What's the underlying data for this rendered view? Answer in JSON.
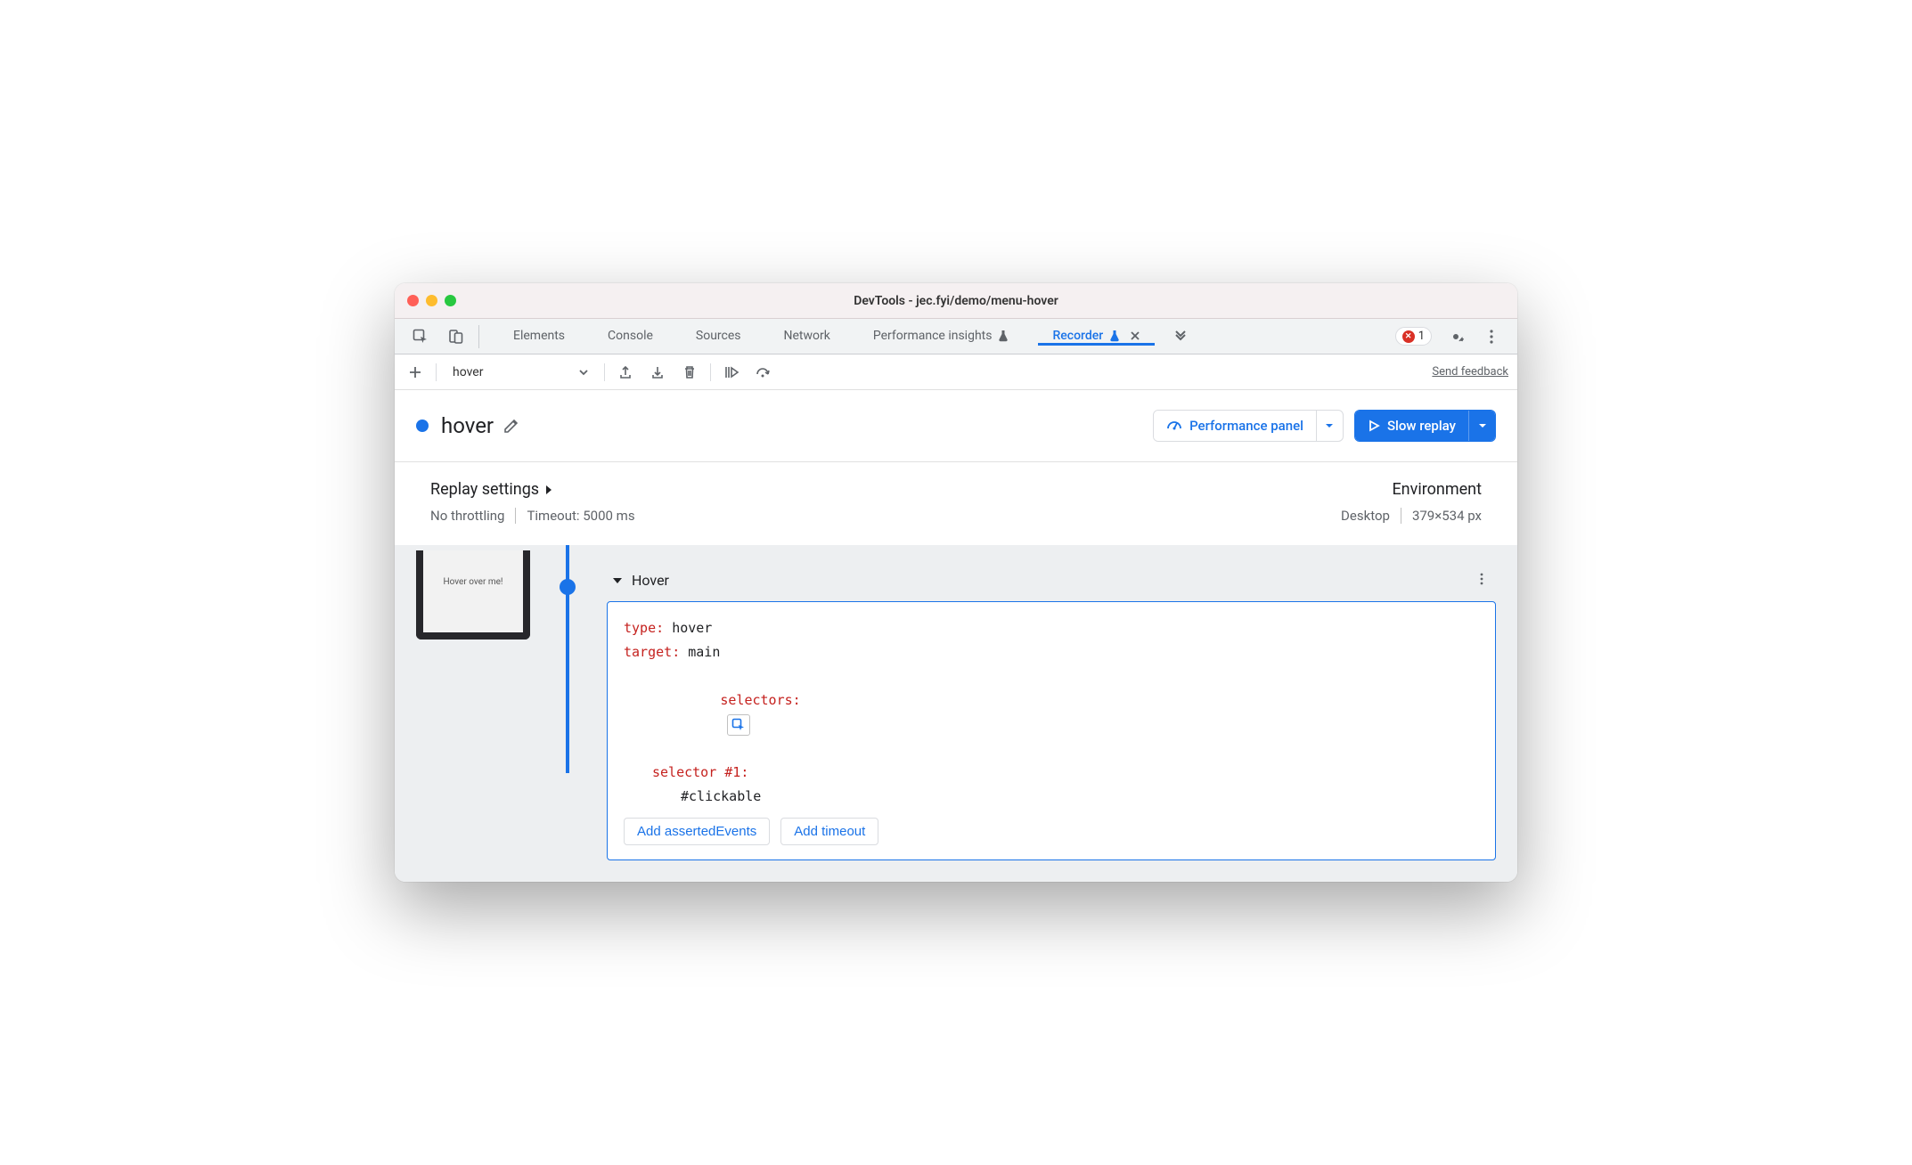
{
  "window": {
    "title": "DevTools - jec.fyi/demo/menu-hover"
  },
  "tabs": {
    "items": [
      "Elements",
      "Console",
      "Sources",
      "Network",
      "Performance insights",
      "Recorder"
    ],
    "active": "Recorder",
    "error_count": "1"
  },
  "toolbar": {
    "recording_selector": "hover",
    "feedback": "Send feedback"
  },
  "recording": {
    "title": "hover",
    "perf_button": "Performance panel",
    "replay_button": "Slow replay"
  },
  "settings": {
    "replay_title": "Replay settings",
    "throttling": "No throttling",
    "timeout": "Timeout: 5000 ms",
    "env_title": "Environment",
    "device": "Desktop",
    "dimensions": "379×534 px"
  },
  "step": {
    "thumb_label": "Hover over me!",
    "name": "Hover",
    "type_key": "type",
    "type_val": "hover",
    "target_key": "target",
    "target_val": "main",
    "selectors_key": "selectors",
    "selector_n_key": "selector #1",
    "selector_val": "#clickable",
    "add_asserted": "Add assertedEvents",
    "add_timeout": "Add timeout"
  }
}
